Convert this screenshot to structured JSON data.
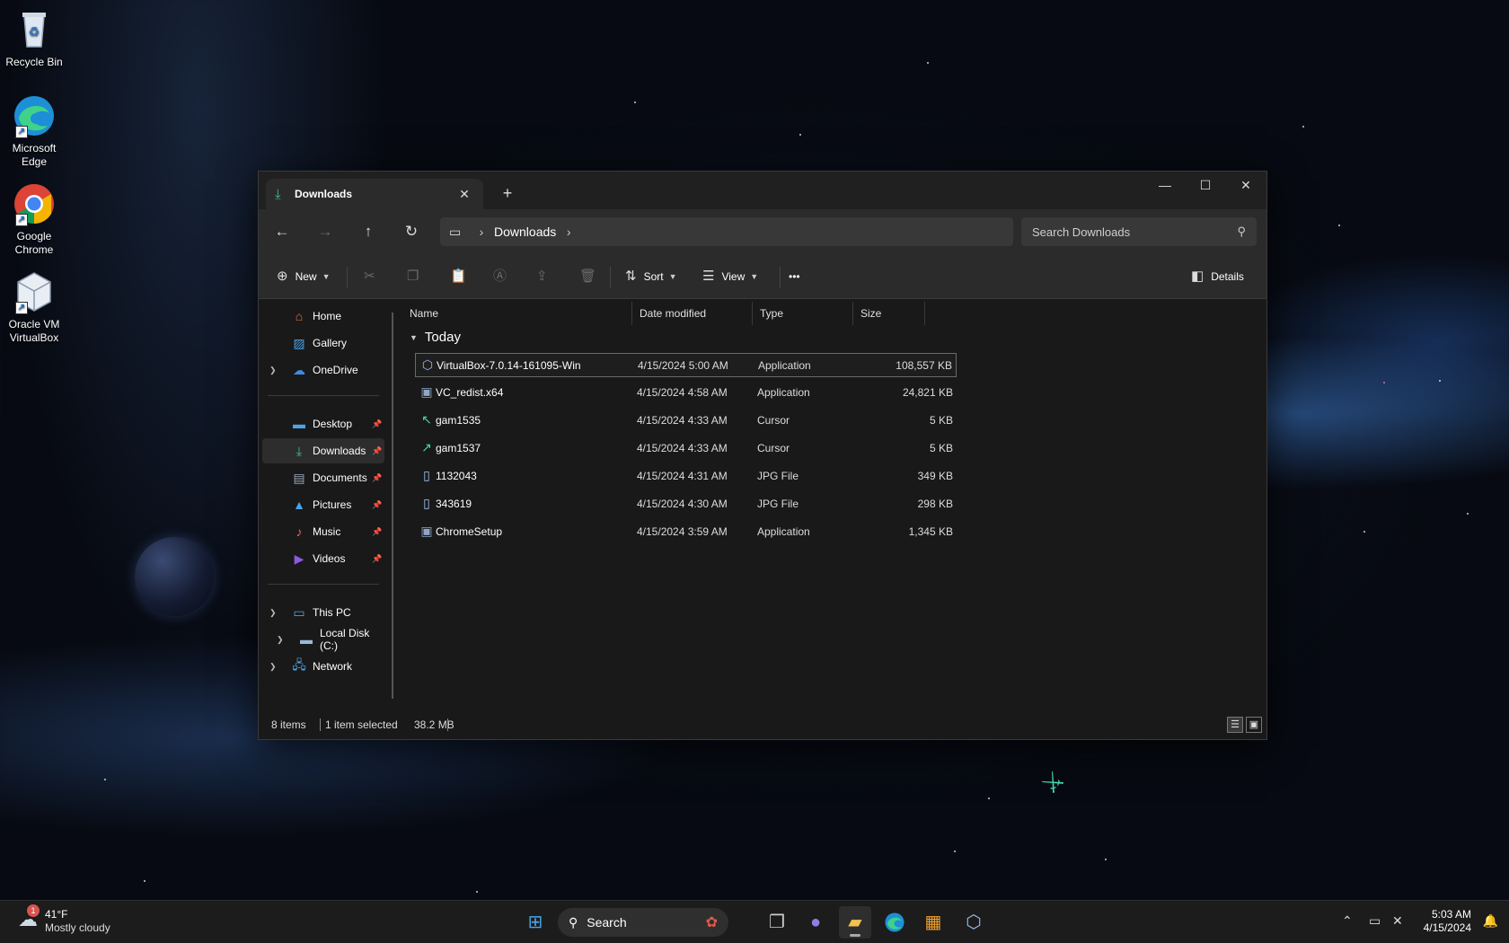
{
  "desktop": {
    "icons": [
      {
        "label": "Recycle Bin",
        "icon": "recycle-bin-icon"
      },
      {
        "label": "Microsoft Edge",
        "icon": "edge-icon"
      },
      {
        "label": "Google Chrome",
        "icon": "chrome-icon"
      },
      {
        "label": "Oracle VM VirtualBox",
        "icon": "virtualbox-icon"
      }
    ]
  },
  "window": {
    "tab_title": "Downloads",
    "tab_icon": "download-icon",
    "breadcrumb": [
      "Downloads"
    ],
    "search_placeholder": "Search Downloads",
    "toolbar": {
      "new_label": "New",
      "sort_label": "Sort",
      "view_label": "View",
      "details_label": "Details",
      "more_label": "•••"
    },
    "sidebar": {
      "quick": [
        {
          "label": "Home",
          "icon": "home-icon",
          "color": "#e8744a"
        },
        {
          "label": "Gallery",
          "icon": "gallery-icon",
          "color": "#4aa3e8"
        },
        {
          "label": "OneDrive",
          "icon": "onedrive-icon",
          "color": "#3b8de0"
        }
      ],
      "pinned": [
        {
          "label": "Desktop",
          "icon": "desktop-icon",
          "color": "#4aa3e8"
        },
        {
          "label": "Downloads",
          "icon": "download-icon",
          "color": "#3ac58a"
        },
        {
          "label": "Documents",
          "icon": "documents-icon",
          "color": "#9aa7b8"
        },
        {
          "label": "Pictures",
          "icon": "pictures-icon",
          "color": "#4aa3e8"
        },
        {
          "label": "Music",
          "icon": "music-icon",
          "color": "#e06a5a"
        },
        {
          "label": "Videos",
          "icon": "videos-icon",
          "color": "#8a5ae0"
        }
      ],
      "devices": [
        {
          "label": "This PC",
          "icon": "pc-icon",
          "color": "#4aa3e8"
        },
        {
          "label": "Local Disk (C:)",
          "icon": "disk-icon",
          "color": "#9ab8d8"
        },
        {
          "label": "Network",
          "icon": "network-icon",
          "color": "#4aa3e8"
        }
      ]
    },
    "columns": {
      "name": "Name",
      "date": "Date modified",
      "type": "Type",
      "size": "Size"
    },
    "group_label": "Today",
    "files": [
      {
        "name": "VirtualBox-7.0.14-161095-Win",
        "date": "4/15/2024 5:00 AM",
        "type": "Application",
        "size": "108,557 KB",
        "icon": "virtualbox-icon"
      },
      {
        "name": "VC_redist.x64",
        "date": "4/15/2024 4:58 AM",
        "type": "Application",
        "size": "24,821 KB",
        "icon": "installer-icon"
      },
      {
        "name": "gam1535",
        "date": "4/15/2024 4:33 AM",
        "type": "Cursor",
        "size": "5 KB",
        "icon": "cursor-file-icon"
      },
      {
        "name": "gam1537",
        "date": "4/15/2024 4:33 AM",
        "type": "Cursor",
        "size": "5 KB",
        "icon": "cursor-file-icon"
      },
      {
        "name": "1132043",
        "date": "4/15/2024 4:31 AM",
        "type": "JPG File",
        "size": "349 KB",
        "icon": "jpg-file-icon"
      },
      {
        "name": "343619",
        "date": "4/15/2024 4:30 AM",
        "type": "JPG File",
        "size": "298 KB",
        "icon": "jpg-file-icon"
      },
      {
        "name": "ChromeSetup",
        "date": "4/15/2024 3:59 AM",
        "type": "Application",
        "size": "1,345 KB",
        "icon": "chrome-setup-icon"
      }
    ],
    "status": {
      "items": "8 items",
      "selected": "1 item selected",
      "selected_size": "38.2 MB"
    }
  },
  "taskbar": {
    "weather_temp": "41°F",
    "weather_desc": "Mostly cloudy",
    "weather_badge": "1",
    "search_label": "Search",
    "time": "5:03 AM",
    "date": "4/15/2024"
  },
  "colors": {
    "accent": "#3ac58a",
    "selection_border": "#6a6a6a",
    "window_bg": "#191919"
  }
}
